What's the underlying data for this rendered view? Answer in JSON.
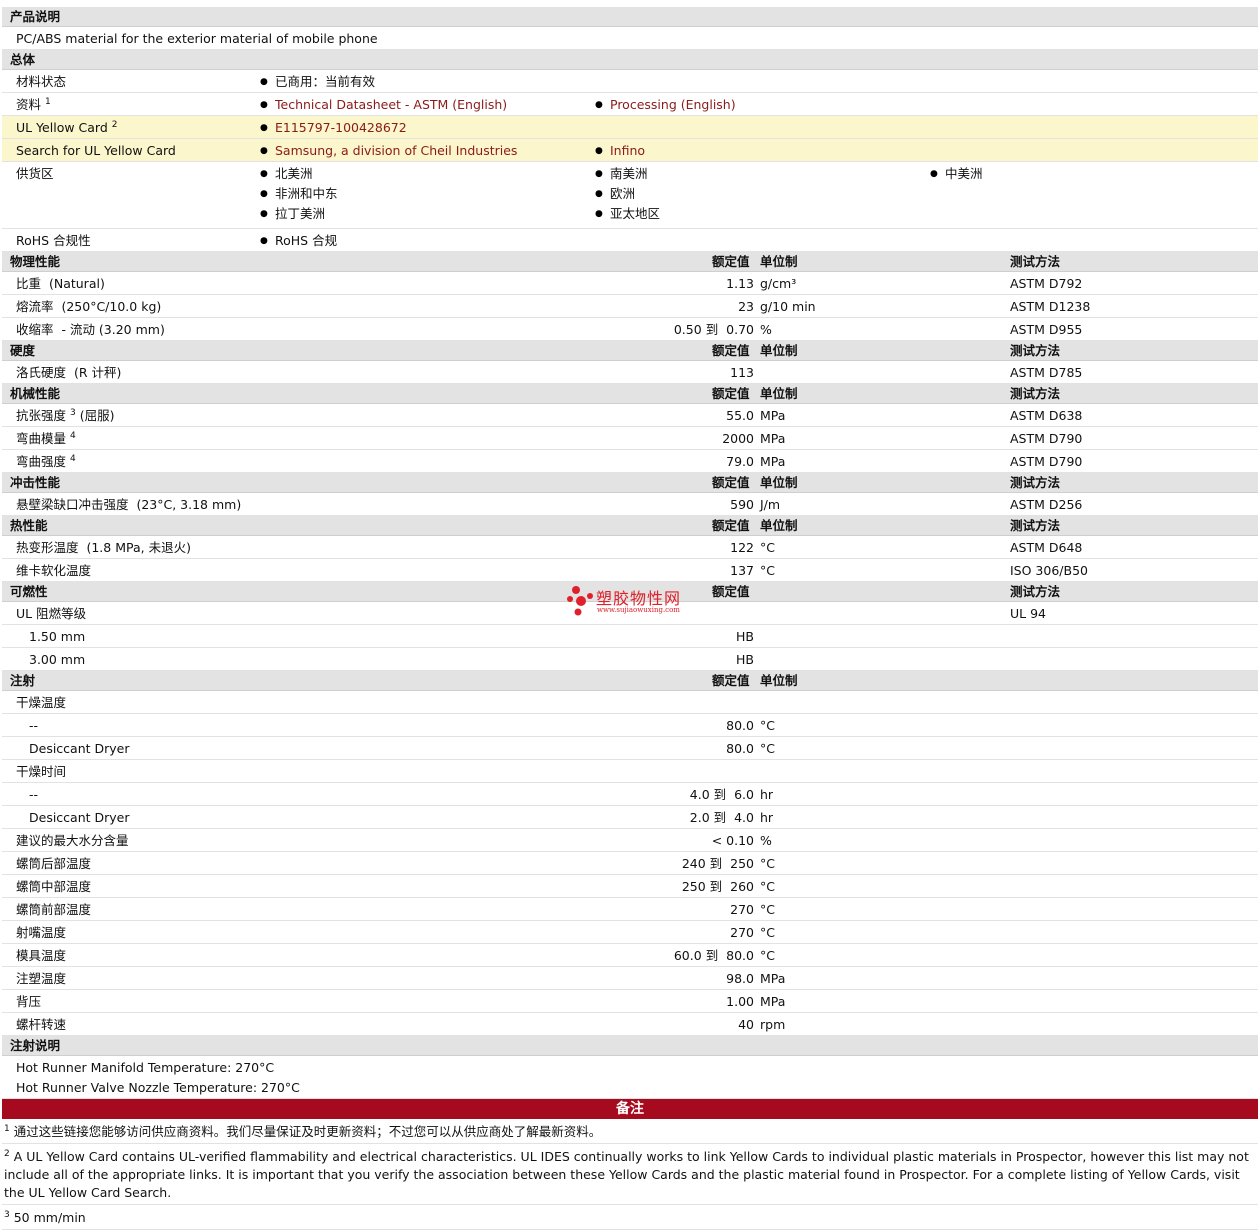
{
  "desc": {
    "title": "产品说明",
    "text": "PC/ABS material for the exterior material of mobile phone"
  },
  "general": {
    "title": "总体",
    "status_label": "材料状态",
    "status_value": "已商用：当前有效",
    "docs_label": "资料",
    "docs_sup": "1",
    "doc1": "Technical Datasheet - ASTM (English)",
    "doc2": "Processing (English)",
    "ul_label": "UL Yellow Card",
    "ul_sup": "2",
    "ul_value": "E115797-100428672",
    "search_label": "Search for UL Yellow Card",
    "search1": "Samsung, a division of Cheil Industries",
    "search2": "Infino",
    "supply_label": "供货区",
    "supply": [
      "北美洲",
      "南美洲",
      "中美洲",
      "非洲和中东",
      "欧洲",
      "拉丁美洲",
      "亚太地区"
    ],
    "rohs_label": "RoHS 合规性",
    "rohs_value": "RoHS 合规"
  },
  "col": {
    "nominal": "额定值",
    "unit": "单位制",
    "method": "测试方法"
  },
  "physical": {
    "title": "物理性能",
    "rows": [
      {
        "name": "比重",
        "cond": "(Natural)",
        "val": "1.13",
        "unit": "g/cm³",
        "method": "ASTM D792"
      },
      {
        "name": "熔流率",
        "cond": "(250°C/10.0 kg)",
        "val": "23",
        "unit": "g/10 min",
        "method": "ASTM D1238"
      },
      {
        "name": "收缩率",
        "cond": "- 流动 (3.20 mm)",
        "val_a": "0.50",
        "to": "到",
        "val_b": "0.70",
        "unit": "%",
        "method": "ASTM D955"
      }
    ]
  },
  "hardness": {
    "title": "硬度",
    "rows": [
      {
        "name": "洛氏硬度",
        "cond": "(R 计秤)",
        "val": "113",
        "unit": "",
        "method": "ASTM D785"
      }
    ]
  },
  "mech": {
    "title": "机械性能",
    "rows": [
      {
        "name": "抗张强度",
        "sup": "3",
        "cond": "(屈服)",
        "val": "55.0",
        "unit": "MPa",
        "method": "ASTM D638"
      },
      {
        "name": "弯曲模量",
        "sup": "4",
        "cond": "",
        "val": "2000",
        "unit": "MPa",
        "method": "ASTM D790"
      },
      {
        "name": "弯曲强度",
        "sup": "4",
        "cond": "",
        "val": "79.0",
        "unit": "MPa",
        "method": "ASTM D790"
      }
    ]
  },
  "impact": {
    "title": "冲击性能",
    "rows": [
      {
        "name": "悬壁梁缺口冲击强度",
        "cond": "(23°C, 3.18 mm)",
        "val": "590",
        "unit": "J/m",
        "method": "ASTM D256"
      }
    ]
  },
  "thermal": {
    "title": "热性能",
    "rows": [
      {
        "name": "热变形温度",
        "cond": "(1.8 MPa, 未退火)",
        "val": "122",
        "unit": "°C",
        "method": "ASTM D648"
      },
      {
        "name": "维卡软化温度",
        "cond": "",
        "val": "137",
        "unit": "°C",
        "method": "ISO 306/B50"
      }
    ]
  },
  "flam": {
    "title": "可燃性",
    "ul_label": "UL 阻燃等级",
    "ul_method": "UL 94",
    "rows": [
      {
        "t": "1.50 mm",
        "v": "HB"
      },
      {
        "t": "3.00 mm",
        "v": "HB"
      }
    ]
  },
  "inj": {
    "title": "注射",
    "dry_temp": "干燥温度",
    "dry_time": "干燥时间",
    "dash": "--",
    "desiccant": "Desiccant Dryer",
    "dt1": "80.0",
    "dt2": "80.0",
    "c": "°C",
    "hr": "hr",
    "tm1a": "4.0",
    "tm1b": "6.0",
    "tm2a": "2.0",
    "tm2b": "4.0",
    "to": "到",
    "rows": [
      {
        "name": "建议的最大水分含量",
        "a": "< 0.10",
        "b": "",
        "unit": "%"
      },
      {
        "name": "螺筒后部温度",
        "a": "240",
        "b": "250",
        "unit": "°C"
      },
      {
        "name": "螺筒中部温度",
        "a": "250",
        "b": "260",
        "unit": "°C"
      },
      {
        "name": "螺筒前部温度",
        "a": "270",
        "b": "",
        "unit": "°C"
      },
      {
        "name": "射嘴温度",
        "a": "270",
        "b": "",
        "unit": "°C"
      },
      {
        "name": "模具温度",
        "a": "60.0",
        "b": "80.0",
        "unit": "°C"
      },
      {
        "name": "注塑温度",
        "a": "98.0",
        "b": "",
        "unit": "MPa"
      },
      {
        "name": "背压",
        "a": "1.00",
        "b": "",
        "unit": "MPa"
      },
      {
        "name": "螺杆转速",
        "a": "40",
        "b": "",
        "unit": "rpm"
      }
    ]
  },
  "injnote": {
    "title": "注射说明",
    "l1": "Hot Runner Manifold Temperature: 270°C",
    "l2": "Hot Runner Valve Nozzle Temperature: 270°C"
  },
  "notes": {
    "title": "备注",
    "n1s": "1",
    "n1": "通过这些链接您能够访问供应商资料。我们尽量保证及时更新资料；不过您可以从供应商处了解最新资料。",
    "n2s": "2",
    "n2": "A UL Yellow Card contains UL-verified flammability and electrical characteristics. UL IDES continually works to link Yellow Cards to individual plastic materials in Prospector, however this list may not include all of the appropriate links. It is important that you verify the association between these Yellow Cards and the plastic material found in Prospector. For a complete listing of Yellow Cards, visit the UL Yellow Card Search.",
    "n3s": "3",
    "n3": "50 mm/min"
  },
  "watermark": {
    "cn": "塑胶物性网",
    "url": "www.sujiaowuxing.com",
    "color": "#e0202a"
  }
}
